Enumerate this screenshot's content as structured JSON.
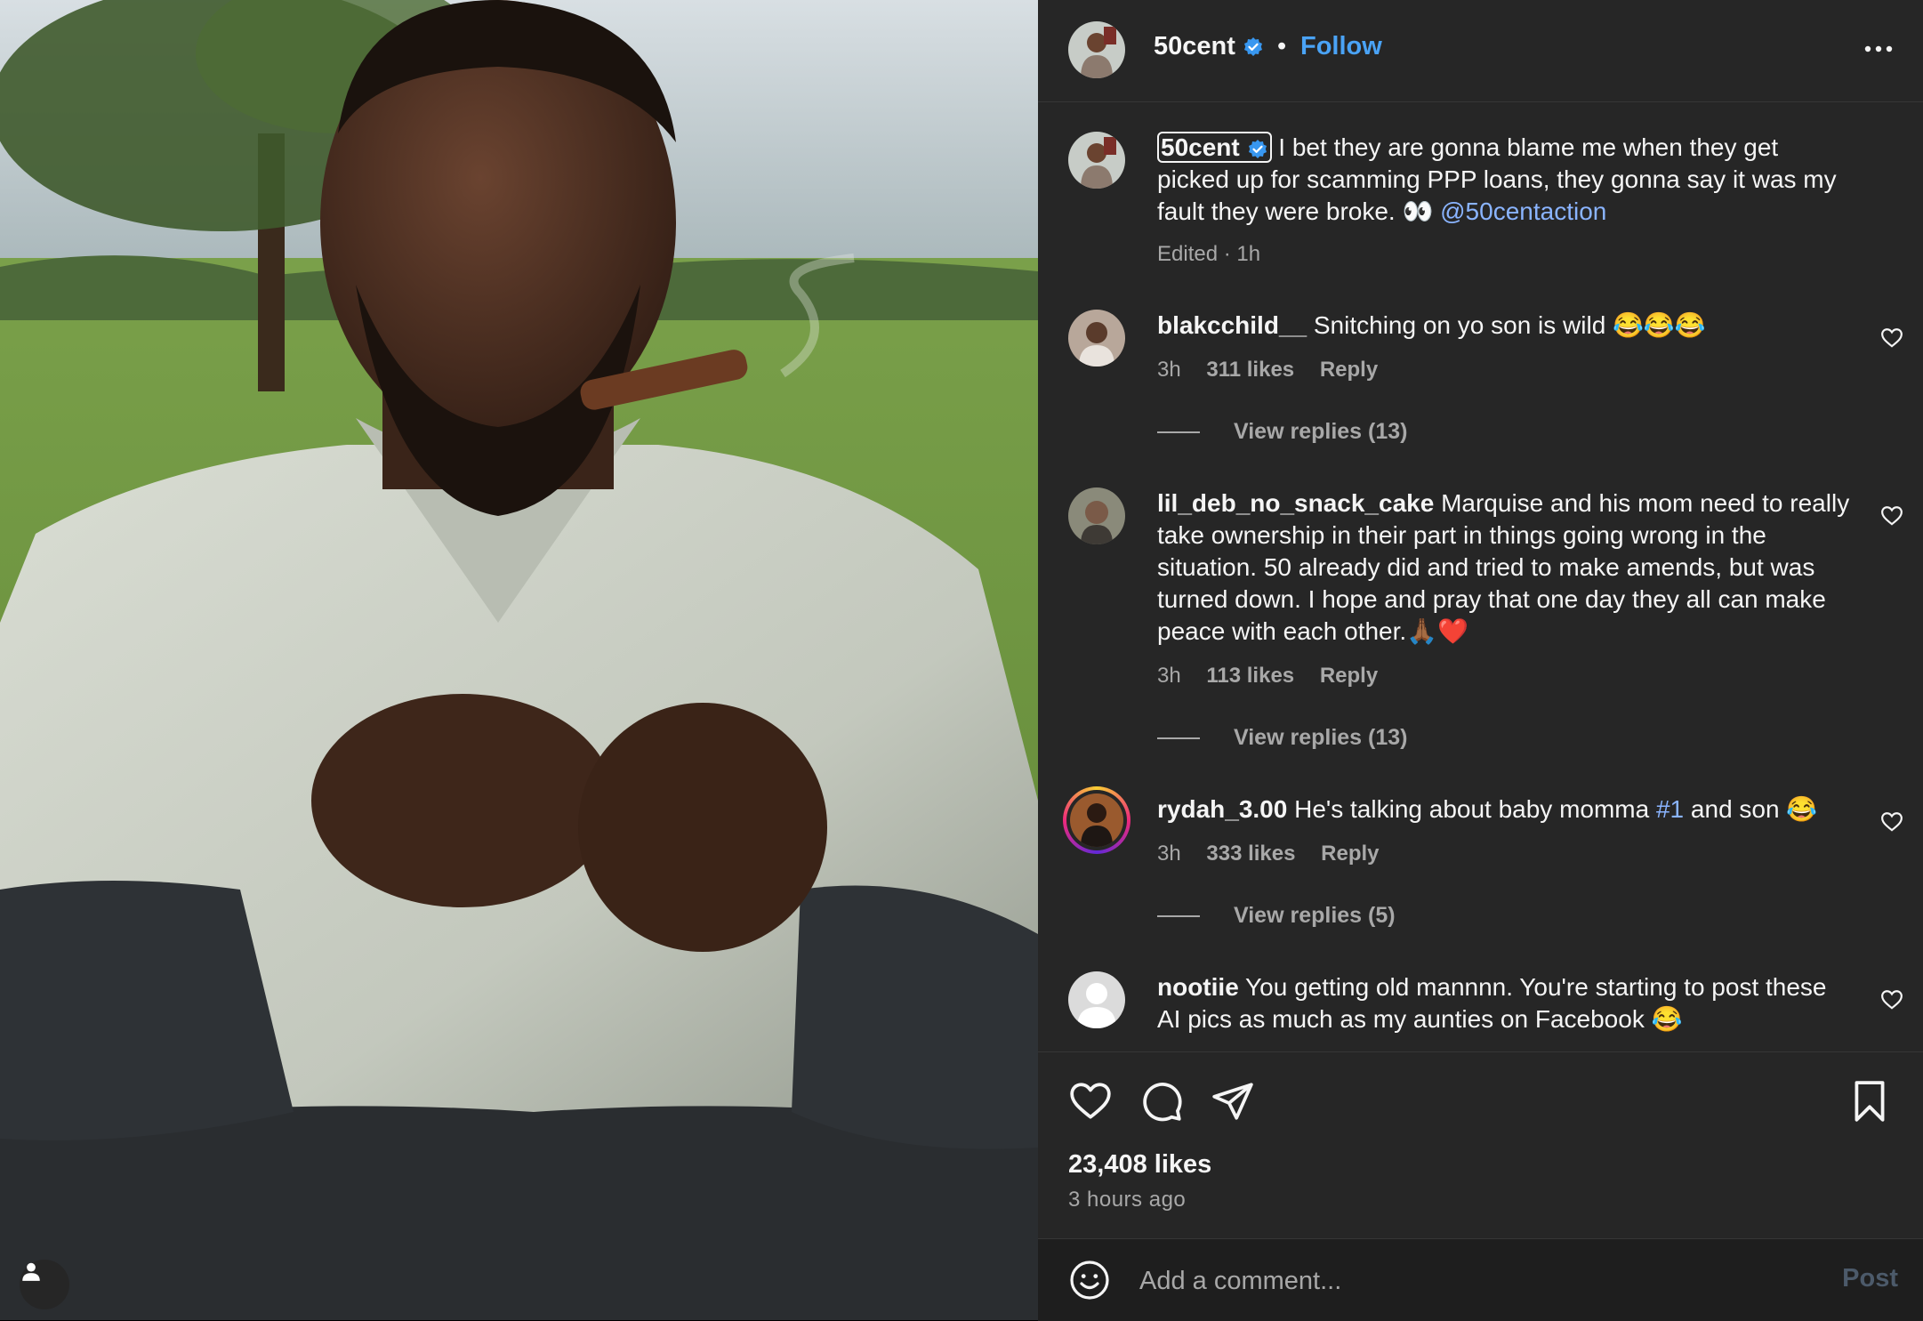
{
  "post": {
    "author": "50cent",
    "follow_label": "Follow",
    "separator": "•"
  },
  "caption": {
    "username": "50cent",
    "text": "I bet they are gonna blame me when they get picked up for scamming PPP loans, they gonna say it was my fault they were broke. 👀",
    "mention": "@50centaction",
    "meta": "Edited · 1h"
  },
  "comments": [
    {
      "username": "blakcchild__",
      "text": "Snitching on yo son is wild 😂😂😂",
      "time": "3h",
      "likes": "311 likes",
      "reply": "Reply",
      "view_replies": "View replies (13)"
    },
    {
      "username": "lil_deb_no_snack_cake",
      "text": "Marquise and his mom need to really take ownership in their part in things going wrong in the situation. 50 already did and tried to make amends, but was turned down. I hope and pray that one day they all can make peace with each other.🙏🏾❤️",
      "time": "3h",
      "likes": "113 likes",
      "reply": "Reply",
      "view_replies": "View replies (13)"
    },
    {
      "username": "rydah_3.00",
      "text_before": "He's talking about baby momma ",
      "hashtag": "#1",
      "text_after": " and son 😂",
      "time": "3h",
      "likes": "333 likes",
      "reply": "Reply",
      "view_replies": "View replies (5)"
    },
    {
      "username": "nootiie",
      "text": "You getting old mannnn. You're starting to post these AI pics as much as my aunties on Facebook 😂"
    }
  ],
  "footer": {
    "likes": "23,408 likes",
    "time": "3 hours ago"
  },
  "add_comment": {
    "placeholder": "Add a comment...",
    "post_label": "Post"
  },
  "icons": {
    "verified": "verified-badge-icon",
    "more": "more-options-icon",
    "like": "heart-icon",
    "comment": "comment-icon",
    "share": "share-icon",
    "save": "bookmark-icon",
    "emoji": "emoji-icon",
    "user_tag": "person-icon"
  },
  "colors": {
    "panel_bg": "#262626",
    "link_blue": "#4aa3f6",
    "mention_blue": "#8ab4ff",
    "muted_text": "#a8a8a8"
  }
}
